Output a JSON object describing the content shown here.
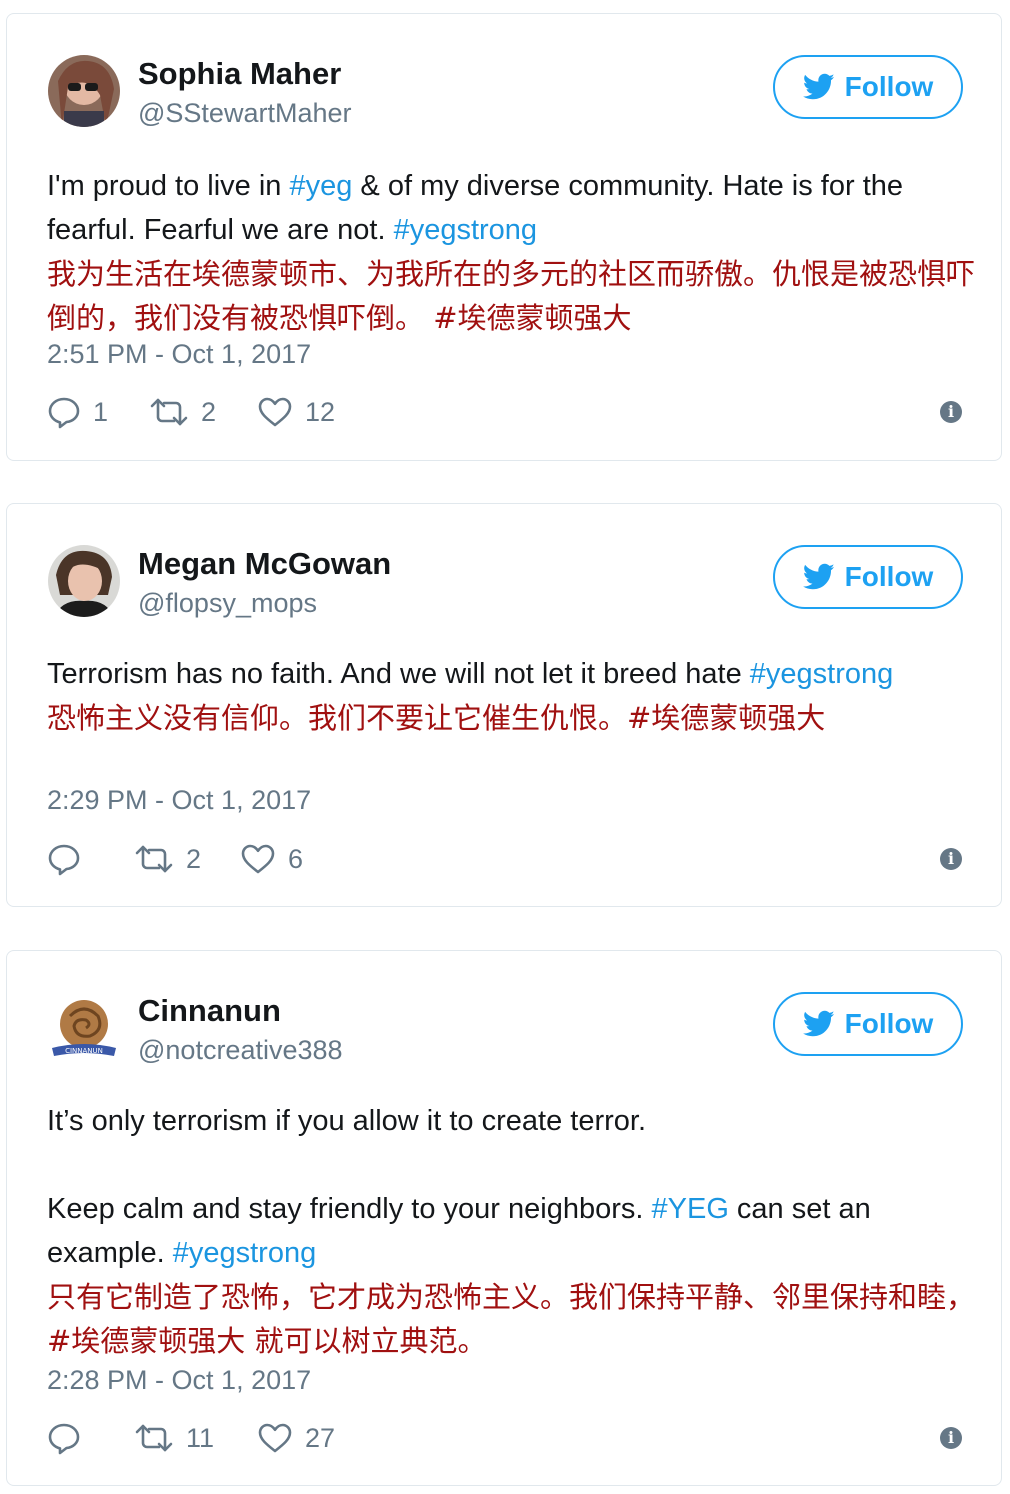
{
  "tweets": [
    {
      "name": "Sophia Maher",
      "handle": "@SStewartMaher",
      "follow_label": "Follow",
      "text": {
        "a": "I'm proud to live in ",
        "b": "#yeg",
        "c": " & of my diverse community. Hate is for the fearful. Fearful we are not. ",
        "d": "#yegstrong"
      },
      "translation": "我为生活在埃德蒙顿市、为我所在的多元的社区而骄傲。仇恨是被恐惧吓倒的，我们没有被恐惧吓倒。 #埃德蒙顿强大",
      "timestamp": "2:51 PM - Oct 1, 2017",
      "replies": "1",
      "retweets": "2",
      "likes": "12",
      "info_icon": "i"
    },
    {
      "name": "Megan McGowan",
      "handle": "@flopsy_mops",
      "follow_label": "Follow",
      "text": {
        "a": "Terrorism has no faith. And we will not let it breed hate ",
        "b": "#yegstrong"
      },
      "translation": "恐怖主义没有信仰。我们不要让它催生仇恨。#埃德蒙顿强大",
      "timestamp": "2:29 PM - Oct 1, 2017",
      "replies": "",
      "retweets": "2",
      "likes": "6",
      "info_icon": "i"
    },
    {
      "name": "Cinnanun",
      "handle": "@notcreative388",
      "follow_label": "Follow",
      "avatar_text": "CINNANUN",
      "text": {
        "line1": "It’s only terrorism if you allow it to create terror.",
        "a": "Keep calm and stay friendly to your neighbors. ",
        "b": "#YEG",
        "c": " can set an example. ",
        "d": "#yegstrong"
      },
      "translation": "只有它制造了恐怖，它才成为恐怖主义。我们保持平静、邻里保持和睦，#埃德蒙顿强大 就可以树立典范。",
      "timestamp": "2:28 PM - Oct 1, 2017",
      "replies": "",
      "retweets": "11",
      "likes": "27",
      "info_icon": "i"
    }
  ],
  "colors": {
    "link": "#1b95e0",
    "follow": "#1da1f2",
    "translation": "#a01010",
    "meta": "#657786"
  },
  "icons": [
    "twitter-bird-icon",
    "reply-icon",
    "retweet-icon",
    "heart-icon",
    "info-icon"
  ]
}
